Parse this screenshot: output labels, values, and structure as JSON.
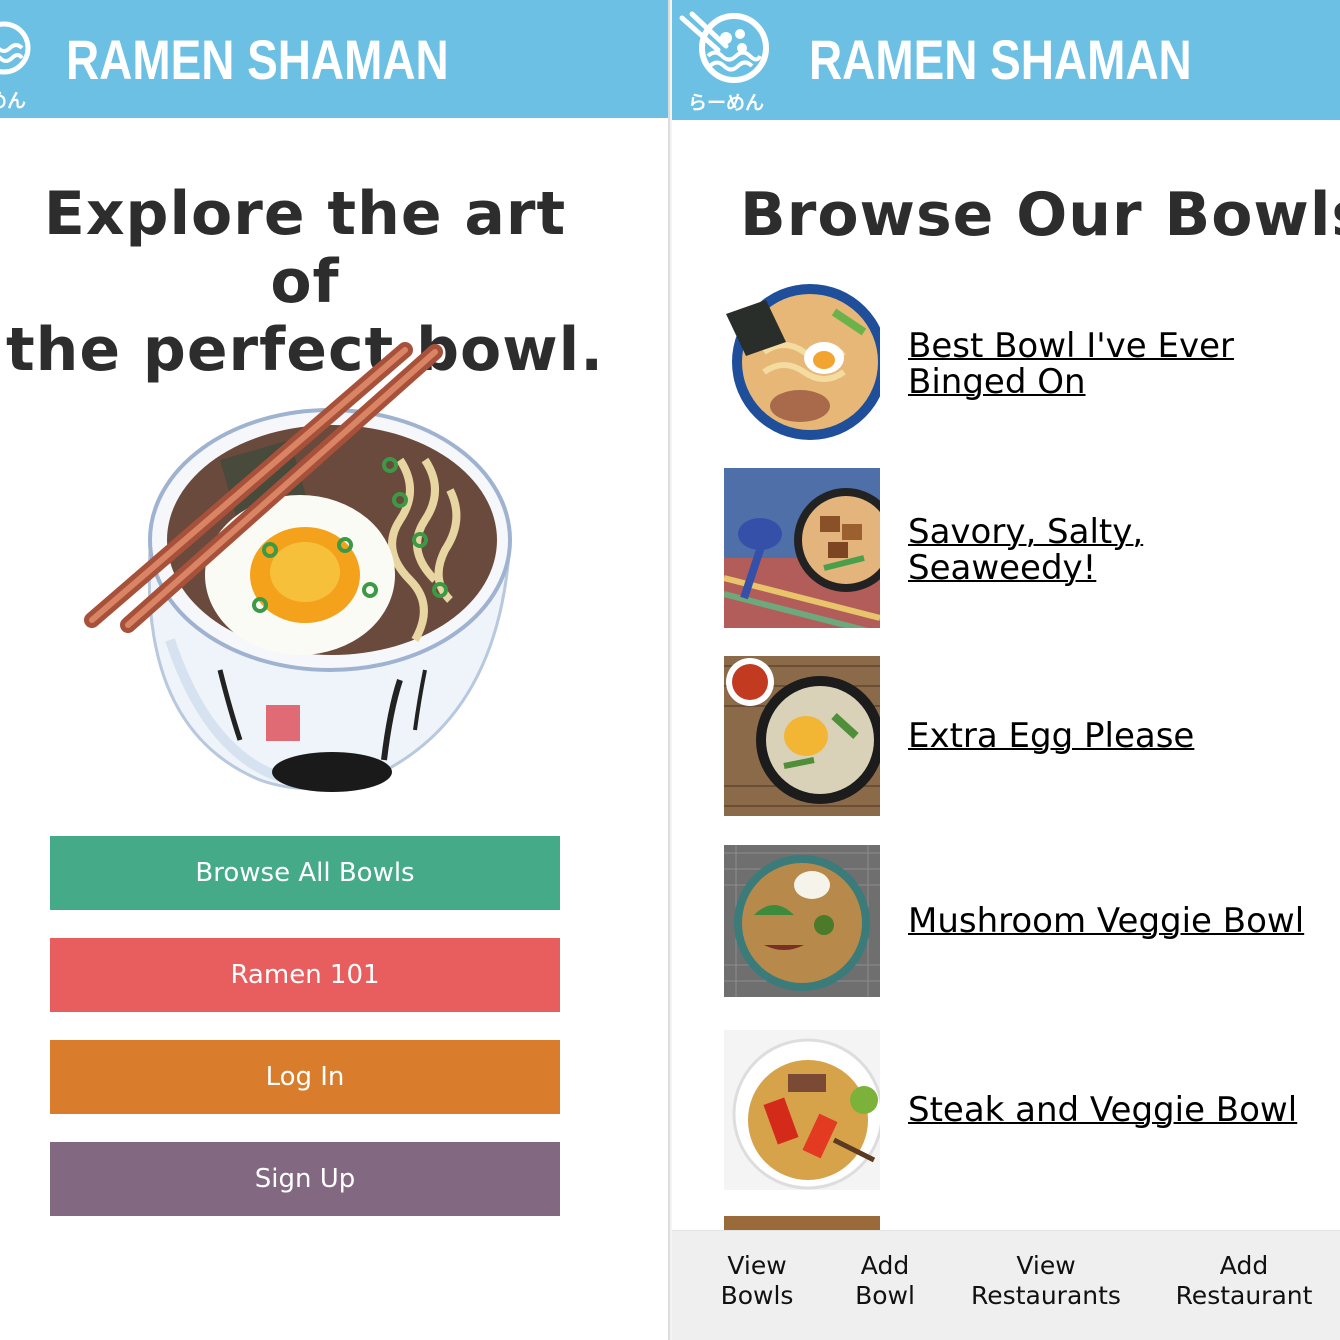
{
  "app": {
    "brand": "RAMEN SHAMAN",
    "logo_subtext": "らーめん"
  },
  "home": {
    "title_line1": "Explore the art of",
    "title_line2": "the perfect bowl.",
    "buttons": [
      {
        "label": "Browse All Bowls",
        "color": "#44aa88"
      },
      {
        "label": "Ramen 101",
        "color": "#e85e5f"
      },
      {
        "label": "Log In",
        "color": "#d97c2b"
      },
      {
        "label": "Sign Up",
        "color": "#836882"
      }
    ]
  },
  "bowls_page": {
    "title": "Browse Our Bowls",
    "items": [
      {
        "line1": "Best Bowl I've Ever",
        "line2": "Binged On"
      },
      {
        "line1": "Savory, Salty,",
        "line2": "Seaweedy!"
      },
      {
        "line1": "Extra Egg Please",
        "line2": ""
      },
      {
        "line1": "Mushroom Veggie Bowl",
        "line2": ""
      },
      {
        "line1": "Steak and Veggie Bowl",
        "line2": ""
      }
    ]
  },
  "bottom_nav": [
    {
      "line1": "View",
      "line2": "Bowls"
    },
    {
      "line1": "Add",
      "line2": "Bowl"
    },
    {
      "line1": "View",
      "line2": "Restaurants"
    },
    {
      "line1": "Add",
      "line2": "Restaurant"
    }
  ],
  "colors": {
    "header": "#6cc0e4",
    "text": "#2d2d2d"
  }
}
